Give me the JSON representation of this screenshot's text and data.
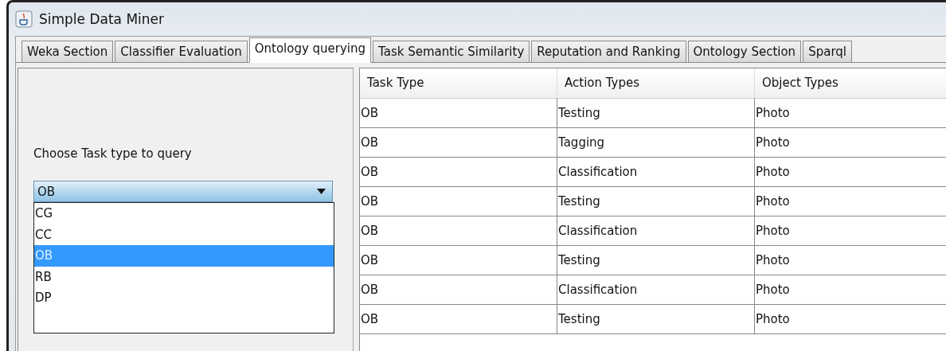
{
  "window": {
    "title": "Simple Data Miner"
  },
  "tabs": [
    {
      "label": "Weka Section",
      "selected": false
    },
    {
      "label": "Classifier Evaluation",
      "selected": false
    },
    {
      "label": "Ontology querying",
      "selected": true
    },
    {
      "label": "Task Semantic Similarity",
      "selected": false
    },
    {
      "label": "Reputation and Ranking",
      "selected": false
    },
    {
      "label": "Ontology Section",
      "selected": false
    },
    {
      "label": "Sparql",
      "selected": false
    }
  ],
  "query": {
    "label": "Choose Task type to query",
    "value": "OB",
    "options": [
      {
        "label": "CG",
        "selected": false
      },
      {
        "label": "CC",
        "selected": false
      },
      {
        "label": "OB",
        "selected": true
      },
      {
        "label": "RB",
        "selected": false
      },
      {
        "label": "DP",
        "selected": false
      }
    ]
  },
  "table": {
    "columns": [
      "Task Type",
      "Action Types",
      "Object Types"
    ],
    "rows": [
      [
        "OB",
        "Testing",
        "Photo"
      ],
      [
        "OB",
        "Tagging",
        "Photo"
      ],
      [
        "OB",
        "Classification",
        "Photo"
      ],
      [
        "OB",
        "Testing",
        "Photo"
      ],
      [
        "OB",
        "Classification",
        "Photo"
      ],
      [
        "OB",
        "Testing",
        "Photo"
      ],
      [
        "OB",
        "Classification",
        "Photo"
      ],
      [
        "OB",
        "Testing",
        "Photo"
      ]
    ]
  }
}
